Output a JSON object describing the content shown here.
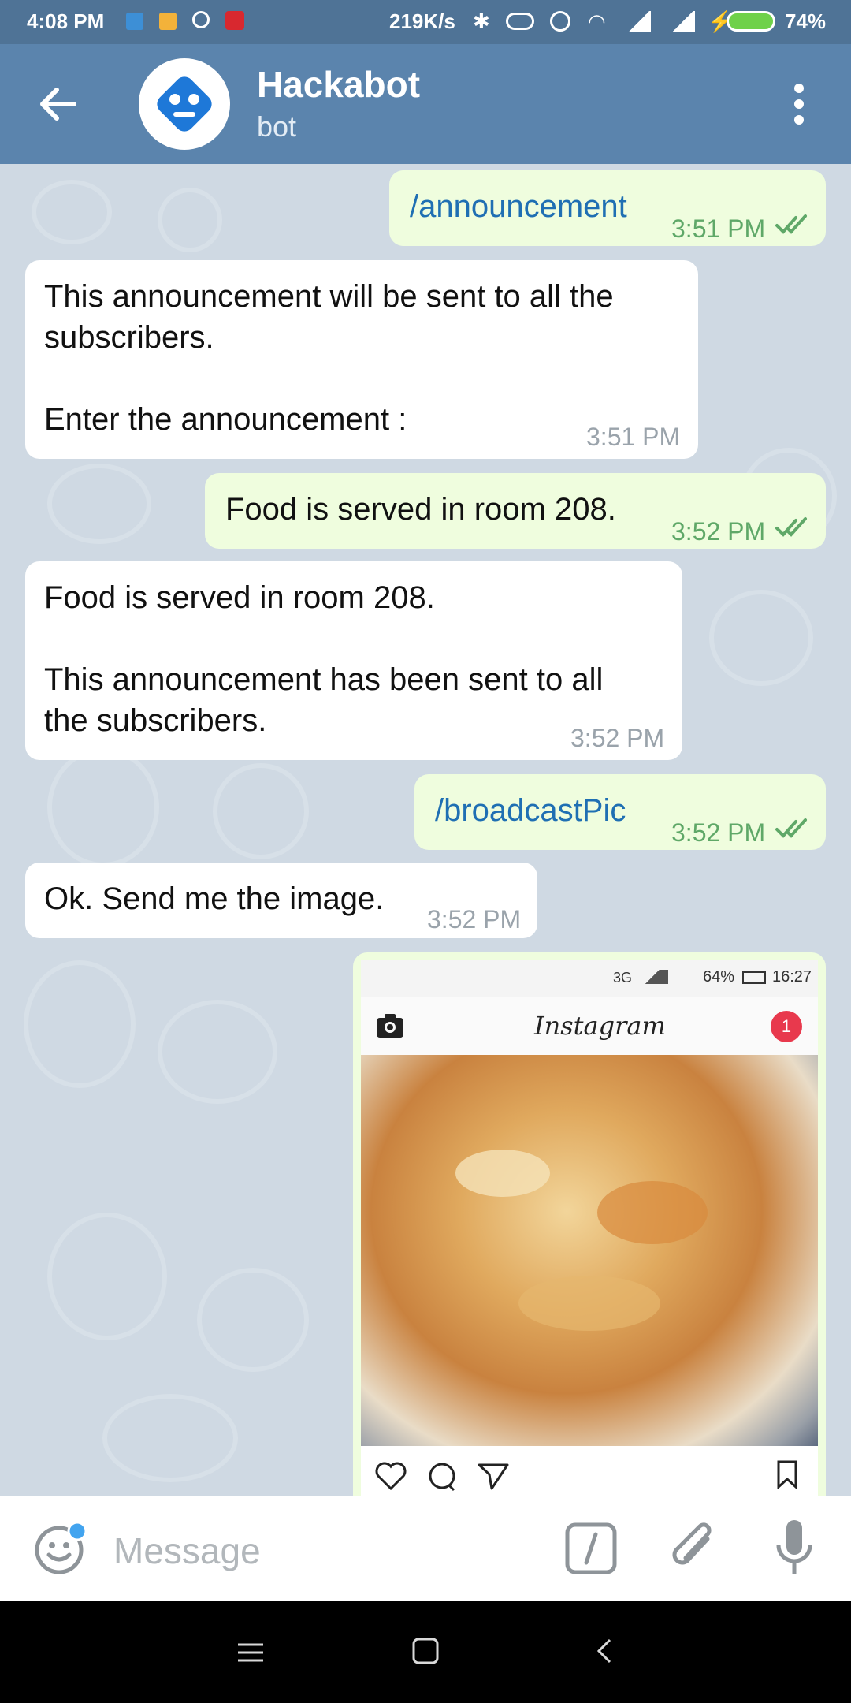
{
  "status_bar": {
    "time": "4:08 PM",
    "net_speed": "219K/s",
    "battery": "74%"
  },
  "header": {
    "title": "Hackabot",
    "subtitle": "bot"
  },
  "messages": [
    {
      "dir": "out",
      "text": "/announcement",
      "time": "3:51 PM"
    },
    {
      "dir": "in",
      "text": "This announcement will be sent to all the\nsubscribers.\n\nEnter the announcement :",
      "time": "3:51 PM"
    },
    {
      "dir": "out",
      "text": "Food is served in room 208.",
      "time": "3:52 PM"
    },
    {
      "dir": "in",
      "text": "Food is served in room 208.\n\nThis announcement has been sent to all\nthe subscribers.",
      "time": "3:52 PM"
    },
    {
      "dir": "out",
      "text": "/broadcastPic",
      "time": "3:52 PM"
    },
    {
      "dir": "in",
      "text": "Ok. Send me the image.",
      "time": "3:52 PM"
    }
  ],
  "photo_message": {
    "inner_status": {
      "network": "3G",
      "battery": "64%",
      "time": "16:27"
    },
    "app_name": "Instagram",
    "notification_count": "1"
  },
  "composer": {
    "placeholder": "Message"
  },
  "colors": {
    "header": "#5b84ad",
    "status_bar": "#4f7396",
    "outgoing_bubble": "#effdde",
    "incoming_bubble": "#ffffff",
    "command_link": "#1f6fb3",
    "read_check": "#5fa868"
  },
  "icons": [
    "back-arrow-icon",
    "more-vertical-icon",
    "bot-avatar-icon",
    "double-check-icon",
    "emoji-icon",
    "bot-command-icon",
    "attach-icon",
    "mic-icon",
    "camera-icon",
    "heart-icon",
    "comment-icon",
    "send-icon",
    "bookmark-icon"
  ]
}
